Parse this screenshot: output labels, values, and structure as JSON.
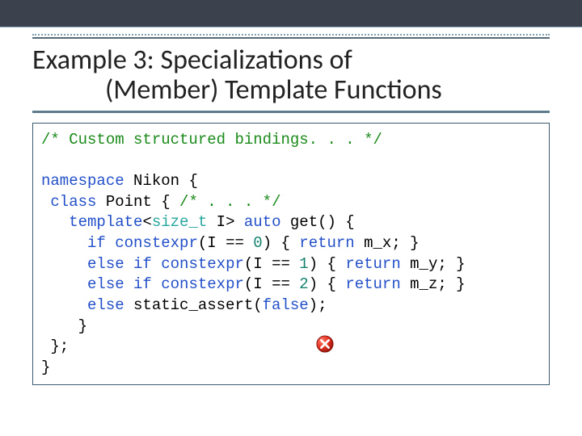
{
  "title": {
    "line1": "Example 3: Specializations of",
    "line2": "(Member) Template Functions"
  },
  "code": {
    "comment1": "/* Custom structured bindings. . . */",
    "ns_kw": "namespace",
    "ns_name": " Nikon {",
    "class_kw": "class",
    "class_name": " Point { ",
    "class_comment": "/* . . . */",
    "tmpl_kw": "template",
    "size_t": "size_t",
    "I_gt": " I> ",
    "auto_kw": "auto",
    "get_sig": " get() {",
    "if_kw": "if",
    "constexpr_kw": "constexpr",
    "eq0_open": "(I == ",
    "num0": "0",
    "eq_close_ret": ") { ",
    "return_kw": "return",
    "mx": " m_x; }",
    "else_kw": "else",
    "num1": "1",
    "my": " m_y; }",
    "num2": "2",
    "mz": " m_z; }",
    "static_assert": " static_assert(",
    "false_kw": "false",
    "sa_close": ");",
    "brace_close1": "    }",
    "brace_close2": " };",
    "brace_close3": "}"
  },
  "icon": {
    "name": "error-icon"
  }
}
